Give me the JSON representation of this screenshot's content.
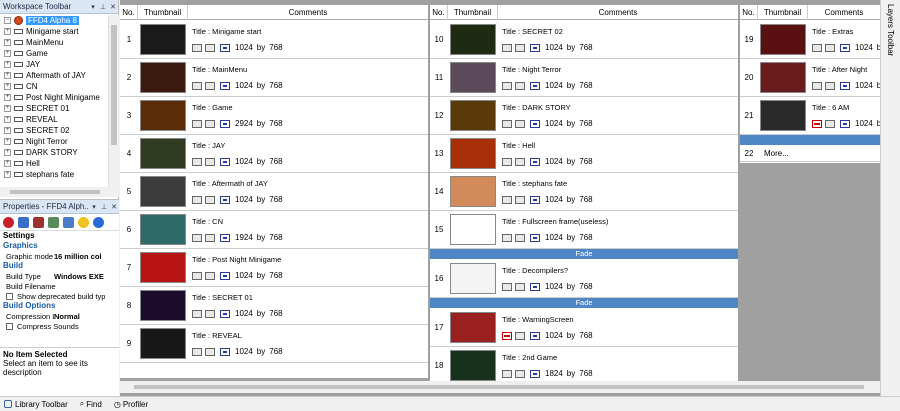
{
  "workspace": {
    "title": "Workspace Toolbar",
    "root": "FFD4 Alpha 8",
    "frames": [
      "Minigame start",
      "MainMenu",
      "Game",
      "JAY",
      "Aftermath of JAY",
      "CN",
      "Post Night Minigame",
      "SECRET 01",
      "REVEAL",
      "SECRET 02",
      "Night Terror",
      "DARK STORY",
      "Hell",
      "stephans fate"
    ]
  },
  "properties": {
    "title": "Properties - FFD4 Alph...",
    "settings": "Settings",
    "graphics": "Graphics",
    "graphic_mode_label": "Graphic mode",
    "graphic_mode_value": "16 million col",
    "build": "Build",
    "build_type_label": "Build Type",
    "build_type_value": "Windows EXE",
    "build_filename_label": "Build Filename",
    "show_deprecated": "Show deprecated build typ",
    "build_options": "Build Options",
    "compression_label": "Compression L",
    "compression_value": "Normal",
    "compress_sounds": "Compress Sounds",
    "desc_title": "No Item Selected",
    "desc_text": "Select an item to see its description"
  },
  "bottom": {
    "library": "Library Toolbar",
    "find": "Find",
    "profiler": "Profiler"
  },
  "right_toolbar": "Layers Toolbar",
  "headers": {
    "no": "No.",
    "thumb": "Thumbnail",
    "comments": "Comments"
  },
  "title_prefix": "Title : ",
  "by": "by",
  "fade": "Fade",
  "more": "More...",
  "columns": [
    [
      {
        "no": "1",
        "title": "Minigame start",
        "w": "1024",
        "h": "768",
        "color": "#1a1a1a"
      },
      {
        "no": "2",
        "title": "MainMenu",
        "w": "1024",
        "h": "768",
        "color": "#3b1a10"
      },
      {
        "no": "3",
        "title": "Game",
        "w": "2924",
        "h": "768",
        "color": "#5a2c08"
      },
      {
        "no": "4",
        "title": "JAY",
        "w": "1024",
        "h": "768",
        "color": "#2f3a20"
      },
      {
        "no": "5",
        "title": "Aftermath of JAY",
        "w": "1024",
        "h": "768",
        "color": "#3c3c3c"
      },
      {
        "no": "6",
        "title": "CN",
        "w": "1924",
        "h": "768",
        "color": "#2f6a6a"
      },
      {
        "no": "7",
        "title": "Post Night Minigame",
        "w": "1024",
        "h": "768",
        "color": "#b81414"
      },
      {
        "no": "8",
        "title": "SECRET 01",
        "w": "1024",
        "h": "768",
        "color": "#1c0c2c"
      },
      {
        "no": "9",
        "title": "REVEAL",
        "w": "1024",
        "h": "768",
        "color": "#181818"
      }
    ],
    [
      {
        "no": "10",
        "title": "SECRET 02",
        "w": "1024",
        "h": "768",
        "color": "#1e2a12"
      },
      {
        "no": "11",
        "title": "Night Terror",
        "w": "1024",
        "h": "768",
        "color": "#5a4a5a"
      },
      {
        "no": "12",
        "title": "DARK STORY",
        "w": "1024",
        "h": "768",
        "color": "#5a3a08"
      },
      {
        "no": "13",
        "title": "Hell",
        "w": "1024",
        "h": "768",
        "color": "#a83008"
      },
      {
        "no": "14",
        "title": "stephans fate",
        "w": "1024",
        "h": "768",
        "color": "#d28a5a"
      },
      {
        "no": "15",
        "title": "Fullscreen frame(useless)",
        "w": "1024",
        "h": "768",
        "color": "#ffffff"
      },
      {
        "no": "16",
        "title": "Decompilers?",
        "w": "1024",
        "h": "768",
        "color": "#f4f4f4"
      },
      {
        "no": "17",
        "title": "WarningScreen",
        "w": "1024",
        "h": "768",
        "color": "#9a2020",
        "red": true
      },
      {
        "no": "18",
        "title": "2nd Game",
        "w": "1824",
        "h": "768",
        "color": "#16321c"
      }
    ],
    [
      {
        "no": "19",
        "title": "Extras",
        "w": "1024",
        "h": "768",
        "color": "#5a1010"
      },
      {
        "no": "20",
        "title": "After Night",
        "w": "1024",
        "h": "768",
        "color": "#6a1c1c"
      },
      {
        "no": "21",
        "title": "6 AM",
        "w": "1024",
        "h": "768",
        "color": "#2a2a2a",
        "red": true
      }
    ]
  ]
}
